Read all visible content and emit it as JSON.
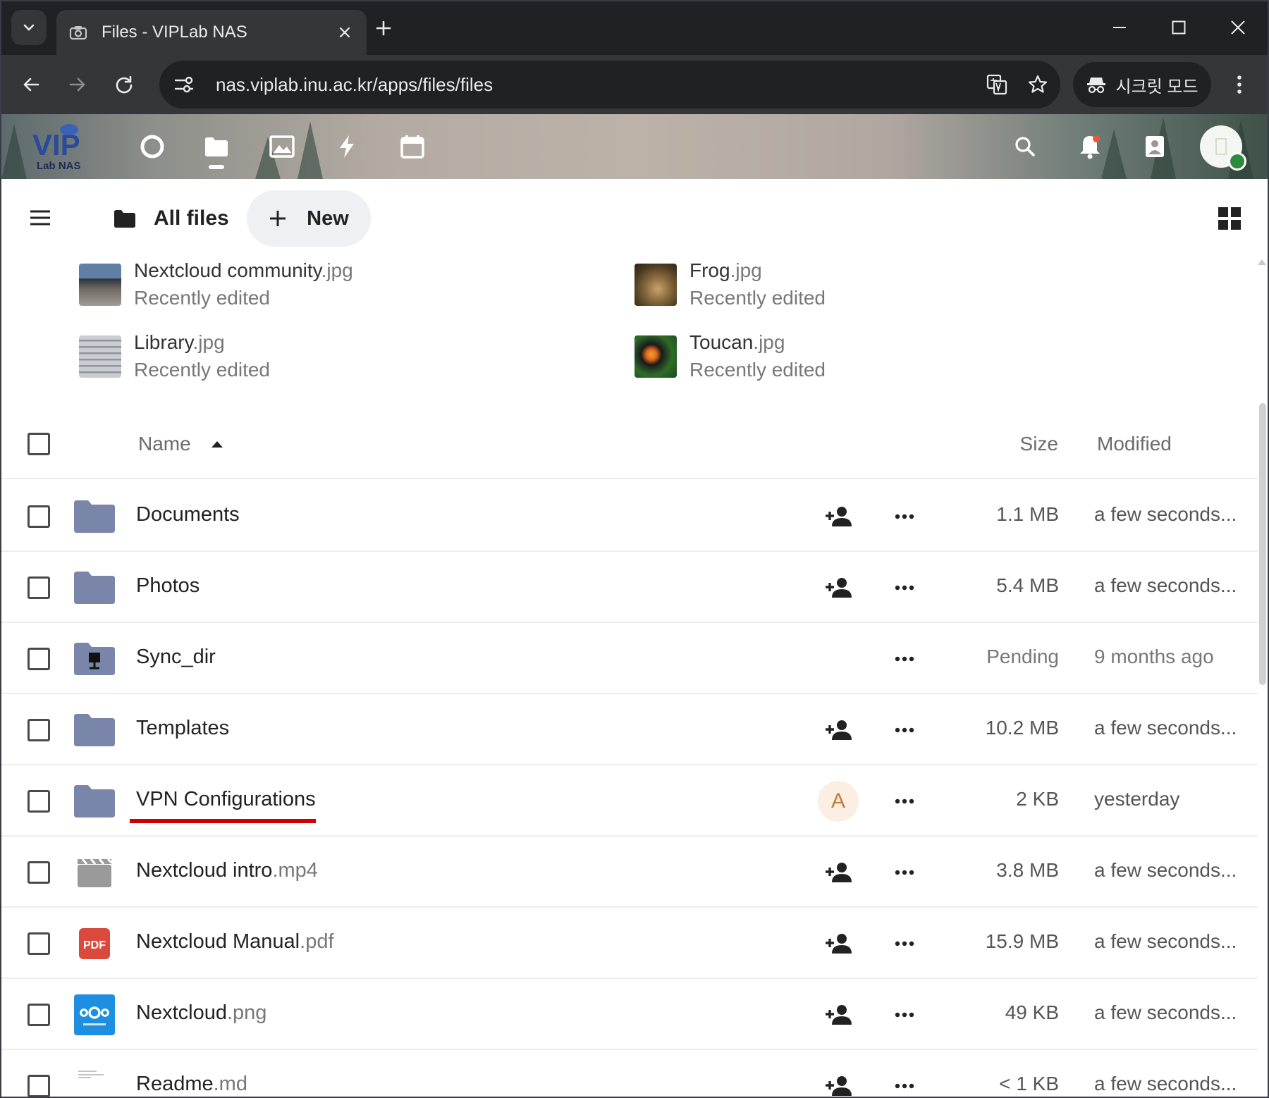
{
  "browser": {
    "tab_title": "Files - VIPLab NAS",
    "url": "nas.viplab.inu.ac.kr/apps/files/files",
    "incognito_label": "시크릿 모드"
  },
  "app": {
    "logo_text": "VIP",
    "logo_subtext": "Lab NAS",
    "nav_icons": [
      "dashboard-icon",
      "files-icon",
      "photos-icon",
      "activity-icon",
      "calendar-icon"
    ],
    "right_icons": [
      "search-icon",
      "notifications-icon",
      "contacts-icon",
      "avatar"
    ]
  },
  "files": {
    "breadcrumb": "All files",
    "new_button": "New",
    "recent": [
      {
        "base": "Nextcloud community",
        "ext": ".jpg",
        "status": "Recently edited"
      },
      {
        "base": "Frog",
        "ext": ".jpg",
        "status": "Recently edited"
      },
      {
        "base": "Library",
        "ext": ".jpg",
        "status": "Recently edited"
      },
      {
        "base": "Toucan",
        "ext": ".jpg",
        "status": "Recently edited"
      }
    ],
    "columns": {
      "name": "Name",
      "size": "Size",
      "modified": "Modified"
    },
    "rows": [
      {
        "base": "Documents",
        "ext": "",
        "type": "folder",
        "size": "1.1 MB",
        "modified": "a few seconds..."
      },
      {
        "base": "Photos",
        "ext": "",
        "type": "folder",
        "size": "5.4 MB",
        "modified": "a few seconds..."
      },
      {
        "base": "Sync_dir",
        "ext": "",
        "type": "folder-external",
        "size": "Pending",
        "modified": "9 months ago"
      },
      {
        "base": "Templates",
        "ext": "",
        "type": "folder",
        "size": "10.2 MB",
        "modified": "a few seconds..."
      },
      {
        "base": "VPN Configurations",
        "ext": "",
        "type": "folder",
        "size": "2 KB",
        "modified": "yesterday",
        "shared_with": "A"
      },
      {
        "base": "Nextcloud intro",
        "ext": ".mp4",
        "type": "video",
        "size": "3.8 MB",
        "modified": "a few seconds..."
      },
      {
        "base": "Nextcloud Manual",
        "ext": ".pdf",
        "type": "pdf",
        "size": "15.9 MB",
        "modified": "a few seconds..."
      },
      {
        "base": "Nextcloud",
        "ext": ".png",
        "type": "image",
        "size": "49 KB",
        "modified": "a few seconds..."
      },
      {
        "base": "Readme",
        "ext": ".md",
        "type": "text",
        "size": "< 1 KB",
        "modified": "a few seconds..."
      }
    ],
    "pdf_badge": "PDF"
  },
  "colors": {
    "folder": "#7a85aa",
    "highlight_underline": "#cc0000",
    "status_online": "#2d8a3e"
  }
}
